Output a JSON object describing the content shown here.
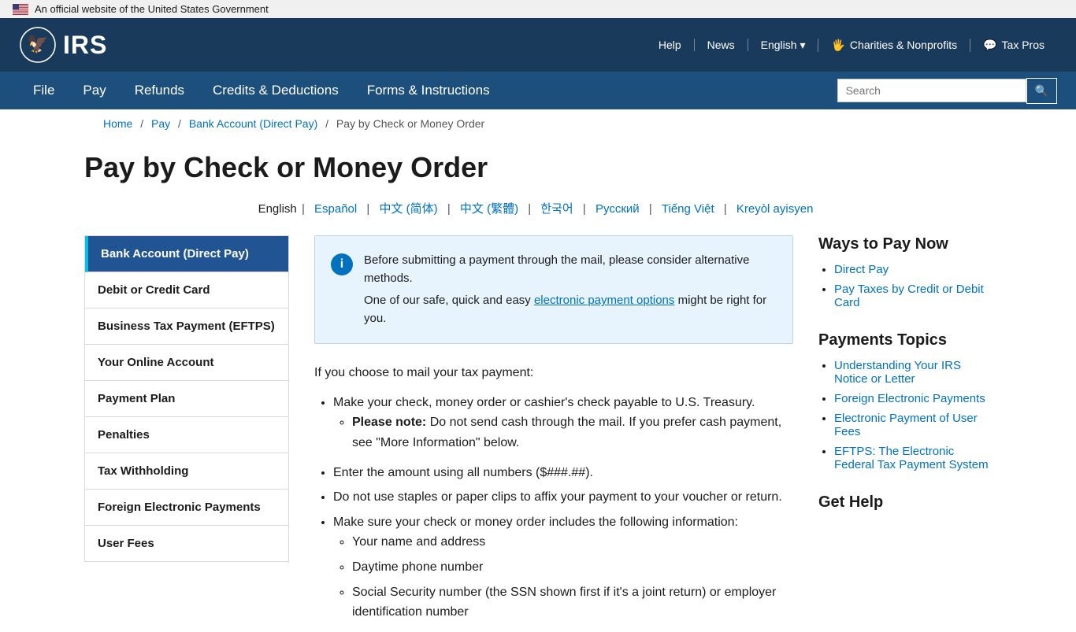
{
  "gov_banner": {
    "text": "An official website of the United States Government"
  },
  "header": {
    "logo_text": "IRS",
    "links": [
      {
        "label": "Help",
        "id": "help"
      },
      {
        "label": "News",
        "id": "news"
      },
      {
        "label": "English",
        "id": "english",
        "has_dropdown": true
      },
      {
        "label": "Charities & Nonprofits",
        "id": "charities",
        "has_icon": true
      },
      {
        "label": "Tax Pros",
        "id": "tax-pros",
        "has_icon": true
      }
    ]
  },
  "nav": {
    "items": [
      {
        "label": "File",
        "id": "file"
      },
      {
        "label": "Pay",
        "id": "pay"
      },
      {
        "label": "Refunds",
        "id": "refunds"
      },
      {
        "label": "Credits & Deductions",
        "id": "credits"
      },
      {
        "label": "Forms & Instructions",
        "id": "forms"
      }
    ],
    "search_placeholder": "Search"
  },
  "breadcrumb": {
    "items": [
      {
        "label": "Home",
        "id": "home"
      },
      {
        "label": "Pay",
        "id": "pay"
      },
      {
        "label": "Bank Account (Direct Pay)",
        "id": "direct-pay"
      },
      {
        "label": "Pay by Check or Money Order",
        "id": "current"
      }
    ]
  },
  "page_title": "Pay by Check or Money Order",
  "languages": [
    {
      "label": "English",
      "id": "en",
      "is_current": true
    },
    {
      "label": "Español",
      "id": "es"
    },
    {
      "label": "中文 (简体)",
      "id": "zh-s"
    },
    {
      "label": "中文 (繁體)",
      "id": "zh-t"
    },
    {
      "label": "한국어",
      "id": "ko"
    },
    {
      "label": "Русский",
      "id": "ru"
    },
    {
      "label": "Tiếng Việt",
      "id": "vi"
    },
    {
      "label": "Kreyòl ayisyen",
      "id": "ht"
    }
  ],
  "sidebar": {
    "items": [
      {
        "label": "Bank Account (Direct Pay)",
        "id": "direct-pay",
        "active": true
      },
      {
        "label": "Debit or Credit Card",
        "id": "debit-credit"
      },
      {
        "label": "Business Tax Payment (EFTPS)",
        "id": "eftps"
      },
      {
        "label": "Your Online Account",
        "id": "online-account"
      },
      {
        "label": "Payment Plan",
        "id": "payment-plan"
      },
      {
        "label": "Penalties",
        "id": "penalties"
      },
      {
        "label": "Tax Withholding",
        "id": "tax-withholding"
      },
      {
        "label": "Foreign Electronic Payments",
        "id": "foreign-electronic"
      },
      {
        "label": "User Fees",
        "id": "user-fees"
      }
    ]
  },
  "info_box": {
    "line1": "Before submitting a payment through the mail, please consider alternative methods.",
    "line2_pre": "One of our safe, quick and easy ",
    "line2_link": "electronic payment options",
    "line2_post": " might be right for you."
  },
  "main_content": {
    "intro": "If you choose to mail your tax payment:",
    "bullet1": "Make your check, money order or cashier's check payable to U.S. Treasury.",
    "bullet1_sub": "Please note: Do not send cash through the mail. If you prefer cash payment, see \"More Information\" below.",
    "bullet2": "Enter the amount using all numbers ($###.##).",
    "bullet3": "Do not use staples or paper clips to affix your payment to your voucher or return.",
    "bullet4": "Make sure your check or money order includes the following information:",
    "sub_bullets": [
      "Your name and address",
      "Daytime phone number",
      "Social Security number (the SSN shown first if it's a joint return) or employer identification number"
    ]
  },
  "right_sidebar": {
    "ways_title": "Ways to Pay Now",
    "ways_items": [
      {
        "label": "Direct Pay",
        "id": "direct-pay"
      },
      {
        "label": "Pay Taxes by Credit or Debit Card",
        "id": "credit-debit"
      }
    ],
    "topics_title": "Payments Topics",
    "topics_items": [
      {
        "label": "Understanding Your IRS Notice or Letter",
        "id": "notice"
      },
      {
        "label": "Foreign Electronic Payments",
        "id": "foreign"
      },
      {
        "label": "Electronic Payment of User Fees",
        "id": "user-fees"
      },
      {
        "label": "EFTPS: The Electronic Federal Tax Payment System",
        "id": "eftps"
      }
    ],
    "help_title": "Get Help"
  }
}
